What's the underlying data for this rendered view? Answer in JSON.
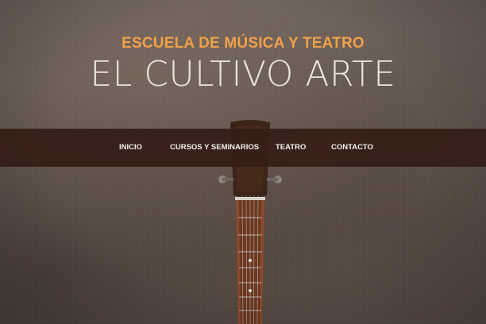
{
  "header": {
    "subtitle": "ESCUELA DE MÚSICA Y TEATRO",
    "title": "EL CULTIVO ARTE"
  },
  "nav": {
    "items": [
      {
        "label": "INICIO"
      },
      {
        "label": "CURSOS Y SEMINARIOS"
      },
      {
        "label": "TEATRO"
      },
      {
        "label": "CONTACTO"
      }
    ]
  },
  "colors": {
    "accent": "#f0a14a",
    "title": "#e9e3dc",
    "navbar_bg": "#341e16",
    "background": "#675a53"
  }
}
